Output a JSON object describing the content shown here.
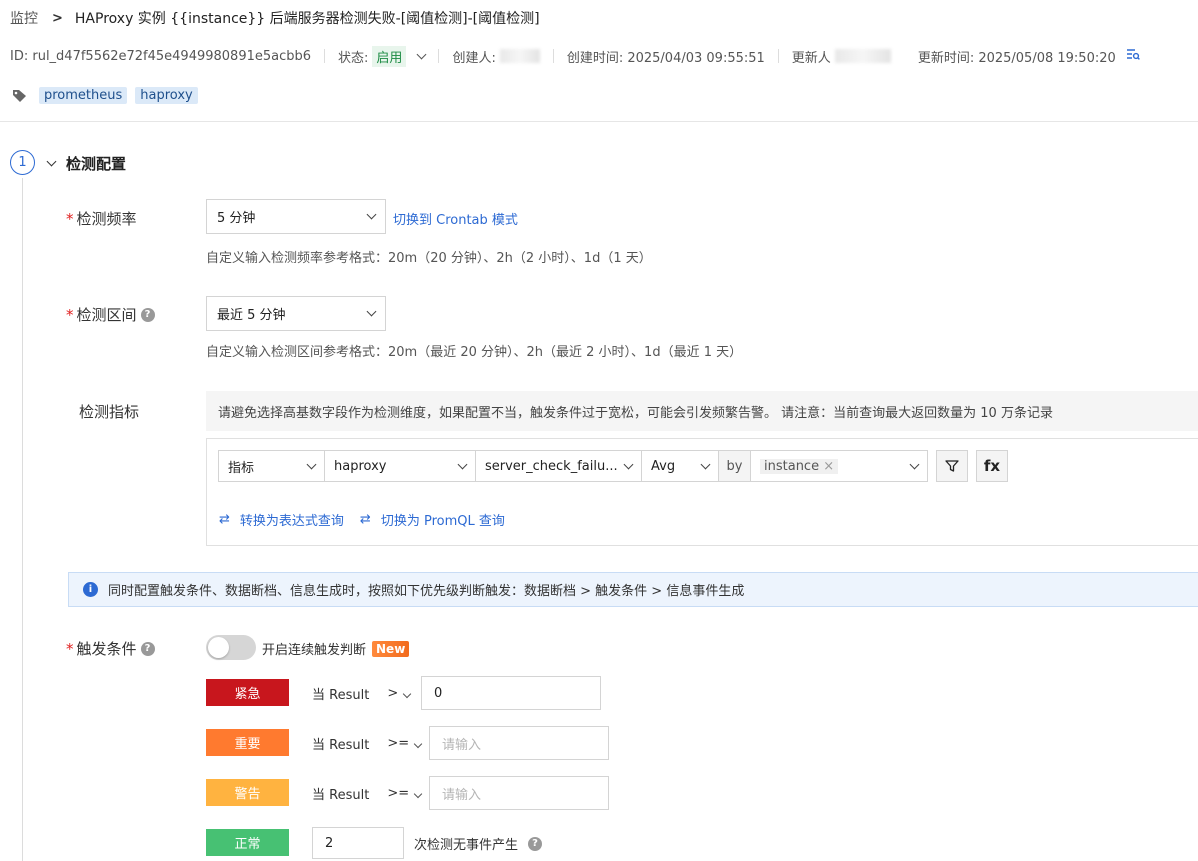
{
  "header": {
    "breadcrumb_root": "监控",
    "title": "HAProxy 实例 {{instance}} 后端服务器检测失败-[阈值检测]-[阈值检测]"
  },
  "meta": {
    "id": "ID: rul_d47f5562e72f45e4949980891e5acbb6",
    "status_label": "状态:",
    "status_value": "启用",
    "creator_label": "创建人:",
    "created_time": "创建时间: 2025/04/03 09:55:51",
    "updater_label": "更新人",
    "updated_time": "更新时间: 2025/05/08 19:50:20"
  },
  "tags": [
    "prometheus",
    "haproxy"
  ],
  "step": {
    "number": "1",
    "title": "检测配置"
  },
  "frequency": {
    "label": "检测频率",
    "value": "5 分钟",
    "switch_link": "切换到 Crontab 模式",
    "hint": "自定义输入检测频率参考格式：20m（20 分钟）、2h（2 小时）、1d（1 天）"
  },
  "interval": {
    "label": "检测区间",
    "value": "最近 5 分钟",
    "hint": "自定义输入检测区间参考格式：20m（最近 20 分钟）、2h（最近 2 小时）、1d（最近 1 天）"
  },
  "metric": {
    "label": "检测指标",
    "note": "请避免选择高基数字段作为检测维度，如果配置不当，触发条件过于宽松，可能会引发频繁告警。 请注意：当前查询最大返回数量为 10 万条记录",
    "type": "指标",
    "source": "haproxy",
    "field": "server_check_failu...",
    "agg": "Avg",
    "by": "by",
    "group": "instance",
    "fx": "fx",
    "to_expression": "转换为表达式查询",
    "to_promql": "切换为 PromQL 查询"
  },
  "info": "同时配置触发条件、数据断档、信息生成时，按照如下优先级判断触发：数据断档 > 触发条件 > 信息事件生成",
  "trigger": {
    "label": "触发条件",
    "toggle_label": "开启连续触发判断",
    "new_badge": "New",
    "rows": [
      {
        "level": "紧急",
        "color": "#c8161d",
        "field": "当 Result",
        "op": ">",
        "value": "0",
        "placeholder": ""
      },
      {
        "level": "重要",
        "color": "#ff7a2f",
        "field": "当 Result",
        "op": ">=",
        "value": "",
        "placeholder": "请输入"
      },
      {
        "level": "警告",
        "color": "#ffb340",
        "field": "当 Result",
        "op": ">=",
        "value": "",
        "placeholder": "请输入"
      }
    ],
    "normal": {
      "level": "正常",
      "color": "#47c173",
      "value": "2",
      "suffix": "次检测无事件产生"
    }
  },
  "icons": {
    "tag": "tag-icon",
    "list": "list-search-icon",
    "info": "info-icon",
    "filter": "filter-icon",
    "swap": "swap-icon",
    "help": "question-icon"
  }
}
